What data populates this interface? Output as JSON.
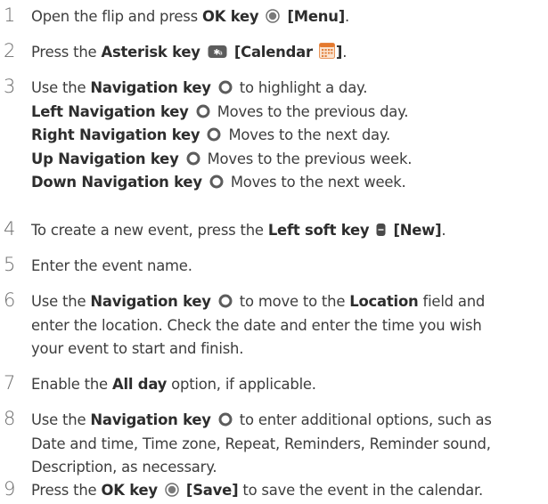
{
  "steps": [
    {
      "num": "1",
      "t1": "Open the flip and press ",
      "b1": "OK key",
      "b2": "[Menu]",
      "t2": "."
    },
    {
      "num": "2",
      "t1": "Press the ",
      "b1": "Asterisk key",
      "b2": "[Calendar",
      "b3": "]",
      "t2": "."
    },
    {
      "num": "3",
      "t1": "Use the ",
      "b1": "Navigation key",
      "t2": " to highlight a day.",
      "sub": [
        {
          "b": "Left Navigation key",
          "t": "Moves to the previous day."
        },
        {
          "b": "Right Navigation key",
          "t": "Moves to the next day."
        },
        {
          "b": "Up Navigation key",
          "t": "Moves to the previous week."
        },
        {
          "b": "Down Navigation key",
          "t": "Moves to the next week."
        }
      ]
    },
    {
      "num": "4",
      "t1": "To create a new event, press the ",
      "b1": "Left soft key",
      "b2": "[New]",
      "t2": "."
    },
    {
      "num": "5",
      "t1": "Enter the event name."
    },
    {
      "num": "6",
      "t1": "Use the ",
      "b1": "Navigation key",
      "t2": " to move to the ",
      "b2": "Location",
      "t3": " field and",
      "l2": "enter the location. Check the date and enter the time you wish",
      "l3": "your event to start and finish."
    },
    {
      "num": "7",
      "t1": "Enable the ",
      "b1": "All day",
      "t2": " option, if applicable."
    },
    {
      "num": "8",
      "t1": "Use the ",
      "b1": "Navigation key",
      "t2": " to enter additional options, such as",
      "l2": "Date and time, Time zone, Repeat, Reminders, Reminder sound,",
      "l3": "Description, as necessary."
    },
    {
      "num": "9",
      "t1": "Press the ",
      "b1": "OK key",
      "b2": "[Save]",
      "t2": " to save the event in the calendar."
    }
  ],
  "icons": {
    "ok": "ok-key-icon",
    "asterisk": "asterisk-key-icon",
    "calendar": "calendar-app-icon",
    "nav": "navigation-key-icon",
    "soft": "left-soft-key-icon"
  }
}
